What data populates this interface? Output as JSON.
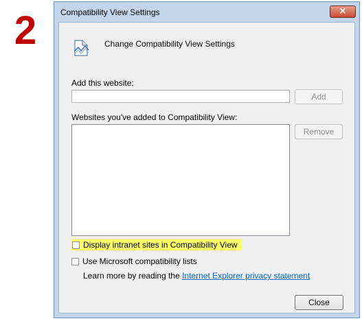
{
  "annotation": {
    "step_number": "2"
  },
  "dialog": {
    "title": "Compatibility View Settings",
    "close_glyph": "×",
    "header_icon": "compatibility-view-icon",
    "header_text": "Change Compatibility View Settings",
    "add_website": {
      "label": "Add this website:",
      "value": "",
      "placeholder": "",
      "button_label": "Add",
      "button_enabled": false
    },
    "sites_list": {
      "label": "Websites you've added to Compatibility View:",
      "items": [],
      "remove_label": "Remove",
      "remove_enabled": false
    },
    "options": [
      {
        "label": "Display intranet sites in Compatibility View",
        "checked": false,
        "highlighted": true,
        "highlight_color": "#ffff66"
      },
      {
        "label": "Use Microsoft compatibility lists",
        "checked": false,
        "highlighted": false
      }
    ],
    "learn_more": {
      "prefix": "Learn more by reading the ",
      "link_text": "Internet Explorer privacy statement"
    },
    "close_button_label": "Close"
  },
  "colors": {
    "step_number": "#c00000",
    "frame": "#c2d5ea",
    "link": "#0066cc",
    "close_x": "#c84e34"
  }
}
